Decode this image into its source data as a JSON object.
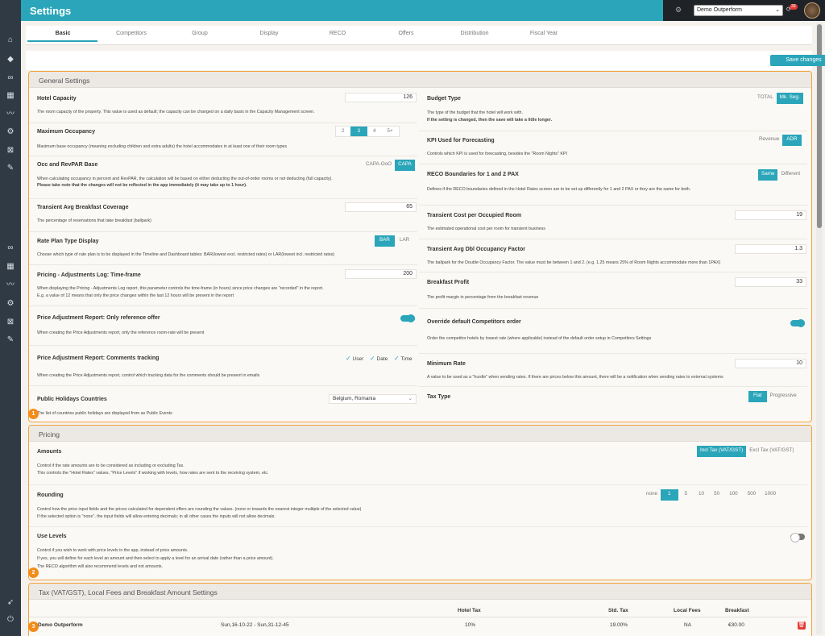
{
  "header": {
    "title": "Settings",
    "hotel_select": "Demo Outperform",
    "notifications_count": "33"
  },
  "tabs": [
    "Basic",
    "Competitors",
    "Group",
    "Display",
    "RECO",
    "Offers",
    "Distribution",
    "Fiscal Year"
  ],
  "toolbar": {
    "save_label": "Save changes"
  },
  "general": {
    "title": "General Settings",
    "badge": "1",
    "left": {
      "hotel_capacity": {
        "title": "Hotel Capacity",
        "value": "126",
        "desc": "The room capacity of the property. This value is used as default; the capacity can be changed on a daily basis in the Capacity Management screen."
      },
      "max_occupancy": {
        "title": "Maximum Occupancy",
        "options": [
          "2",
          "3",
          "4",
          "5+"
        ],
        "desc": "Maximum base occupancy (meaning excluding children and extra adults) the hotel accommodates in at least one of their room types"
      },
      "occ_revpar": {
        "title": "Occ and RevPAR Base",
        "options": [
          "CAPA-OoO",
          "CAPA"
        ],
        "desc": "When calculating occupancy in percent and RevPAR, the calculation will be based on either deducting the out-of-order rooms or not deducting (full capacity).",
        "desc_bold": "Please take note that the changes will not be reflected in the app immediately (it may take up to 1 hour)."
      },
      "breakfast_coverage": {
        "title": "Transient Avg Breakfast Coverage",
        "value": "65",
        "desc": "The percentage of reservations that take breakfast (ballpark)"
      },
      "rate_plan": {
        "title": "Rate Plan Type Display",
        "options": [
          "BAR",
          "LAR"
        ],
        "desc": "Choose which type of rate plan is to be displayed in the Timeline and Dashboard tables: BAR(lowest excl. restricted rates) or LAR(lowest incl. restricted rates)"
      },
      "pricing_log": {
        "title": "Pricing - Adjustments Log: Time-frame",
        "value": "200",
        "desc1": "When displaying the Pricing - Adjustments Log report, this parameter controls the time-frame (in hours) since price changes are \"recorded\" in the report.",
        "desc2": "E.g. a value of 12 means that only the price changes within the last 12 hours will be present in the report"
      },
      "price_adj_ref": {
        "title": "Price Adjustment Report: Only reference offer",
        "desc": "When creating the Price Adjustments report, only the reference room-rate will be present"
      },
      "price_adj_comments": {
        "title": "Price Adjustment Report: Comments tracking",
        "checks": [
          "User",
          "Date",
          "Time"
        ],
        "desc": "When creating the Price Adjustments report, control which tracking data for the comments should be present in emails"
      },
      "holidays": {
        "title": "Public Holidays Countries",
        "value": "Belgium, Romania",
        "desc": "The list of countries public holidays are displayed from as Public Events"
      }
    },
    "right": {
      "budget_type": {
        "title": "Budget Type",
        "options": [
          "TOTAL",
          "Mk. Seg."
        ],
        "desc": "The type of the budget that the hotel will work with.",
        "desc_bold": "If the setting is changed, then the save will take a little longer."
      },
      "kpi": {
        "title": "KPI Used for Forecasting",
        "options": [
          "Revenue",
          "ADR"
        ],
        "desc": "Controls which KPI is used for forecasting, besides the \"Room Nights\" KPI"
      },
      "reco_boundaries": {
        "title": "RECO Boundaries for 1 and 2 PAX",
        "options": [
          "Same",
          "Different"
        ],
        "desc": "Defines if the RECO boundaries defined in the Hotel Rates screen are to be set up differently for 1 and 2 PAX or they are the same for both."
      },
      "transient_cost": {
        "title": "Transient Cost per Occupied Room",
        "value": "19",
        "desc": "The estimated operational cost per room for transient business"
      },
      "dbl_factor": {
        "title": "Transient Avg Dbl Occupancy Factor",
        "value": "1.3",
        "desc": "The ballpark for the Double Occupancy Factor. The value must be between 1 and 2. (e.g. 1.25 means 25% of Room Nights accommodate more than 1PAX)"
      },
      "breakfast_profit": {
        "title": "Breakfast Profit",
        "value": "33",
        "desc": "The profit margin in percentage from the breakfast revenue"
      },
      "override_comp": {
        "title": "Override default Competitors order",
        "desc": "Order the competitor hotels by lowest rate (where applicable) instead of the default order setup in Competitors Settings"
      },
      "min_rate": {
        "title": "Minimum Rate",
        "value": "10",
        "desc": "A value to be used as a \"hurdle\" when sending rates. If there are prices below this amount, there will be a notification when sending rates to external systems"
      },
      "tax_type": {
        "title": "Tax Type",
        "options": [
          "Flat",
          "Progressive"
        ]
      }
    }
  },
  "pricing": {
    "title": "Pricing",
    "badge": "2",
    "amounts": {
      "title": "Amounts",
      "options": [
        "Incl Tax (VAT/GST)",
        "Excl Tax (VAT/GST)"
      ],
      "desc1": "Control if the rate amounts are to be considered as including or excluding Tax.",
      "desc2": "This controls the \"Hotel Rates\" values, \"Price Levels\" if working with levels, how rates are sent to the receiving system, etc."
    },
    "rounding": {
      "title": "Rounding",
      "options": [
        "none",
        "1",
        "5",
        "10",
        "50",
        "100",
        "500",
        "1000"
      ],
      "desc1": "Control how the price input fields and the prices calculated for dependent offers are rounding the values. (none or towards the nearest integer multiple of the selected value)",
      "desc2": "If the selected option is \"none\", the input fields will allow entering decimals; in all other cases the inputs will not allow decimals."
    },
    "levels": {
      "title": "Use Levels",
      "desc1": "Control if you wish to work with price levels in the app, instead of price amounts.",
      "desc2": "If yes, you will define for each level an amount and then select to apply a level for an arrival date (rather than a price amount).",
      "desc3": "The RECO algorithm will also recommend levels and not amounts."
    }
  },
  "tax": {
    "title": "Tax (VAT/GST), Local Fees and Breakfast Amount Settings",
    "badge": "3",
    "headers": {
      "hotel_tax": "Hotel Tax",
      "std_tax": "Std. Tax",
      "local_fees": "Local Fees",
      "breakfast": "Breakfast"
    },
    "row": {
      "name": "Demo Outperform",
      "period": "Sun,16-10-22 - Sun,31-12-45",
      "hotel_tax": "10%",
      "std_tax": "19.00%",
      "local_fees": "NA",
      "breakfast": "€30.00"
    }
  },
  "colors": {
    "accent": "#2aa5b9",
    "highlight": "#f0a33a",
    "sidebar": "#2f3a45",
    "danger": "#e53935"
  }
}
